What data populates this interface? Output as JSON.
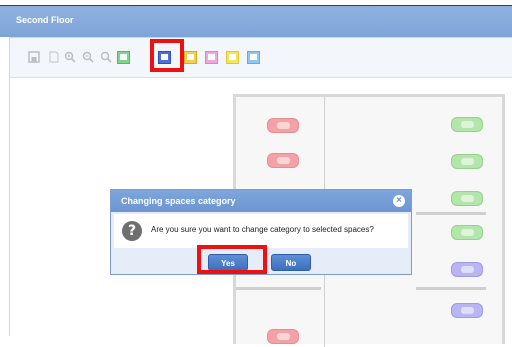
{
  "window": {
    "title": "Second Floor"
  },
  "toolbar": {
    "buttons": [
      {
        "name": "save-icon",
        "color": "#b9bec6"
      },
      {
        "name": "document-icon",
        "color": "#b9bec6"
      },
      {
        "name": "zoom-in-icon",
        "color": "#b9bec6"
      },
      {
        "name": "zoom-out-icon",
        "color": "#b9bec6"
      },
      {
        "name": "zoom-reset-icon",
        "color": "#b9bec6"
      },
      {
        "name": "category-green-icon",
        "color": "#7bd68a"
      },
      {
        "name": "category-blue-icon",
        "color": "#4a6fd6",
        "selected": true
      },
      {
        "name": "category-yellow-icon",
        "color": "#f4cf4a"
      },
      {
        "name": "category-pink-icon",
        "color": "#f2a6df"
      },
      {
        "name": "category-yellow2-icon",
        "color": "#f6e45c"
      },
      {
        "name": "category-lightblue-icon",
        "color": "#8fc7f2"
      }
    ]
  },
  "floor_plan": {
    "spaces_left": [
      "red",
      "red"
    ],
    "spaces_right": [
      "green",
      "green",
      "green",
      "green",
      "blue",
      "blue"
    ],
    "colors": {
      "red": "#f4a2a5",
      "green": "#b3e6aa",
      "blue": "#b8b5f2"
    }
  },
  "dialog": {
    "title": "Changing spaces category",
    "message": "Are you sure you want to change category to selected spaces?",
    "yes_label": "Yes",
    "no_label": "No",
    "close_icon": "close-icon",
    "question_icon": "question-icon"
  }
}
